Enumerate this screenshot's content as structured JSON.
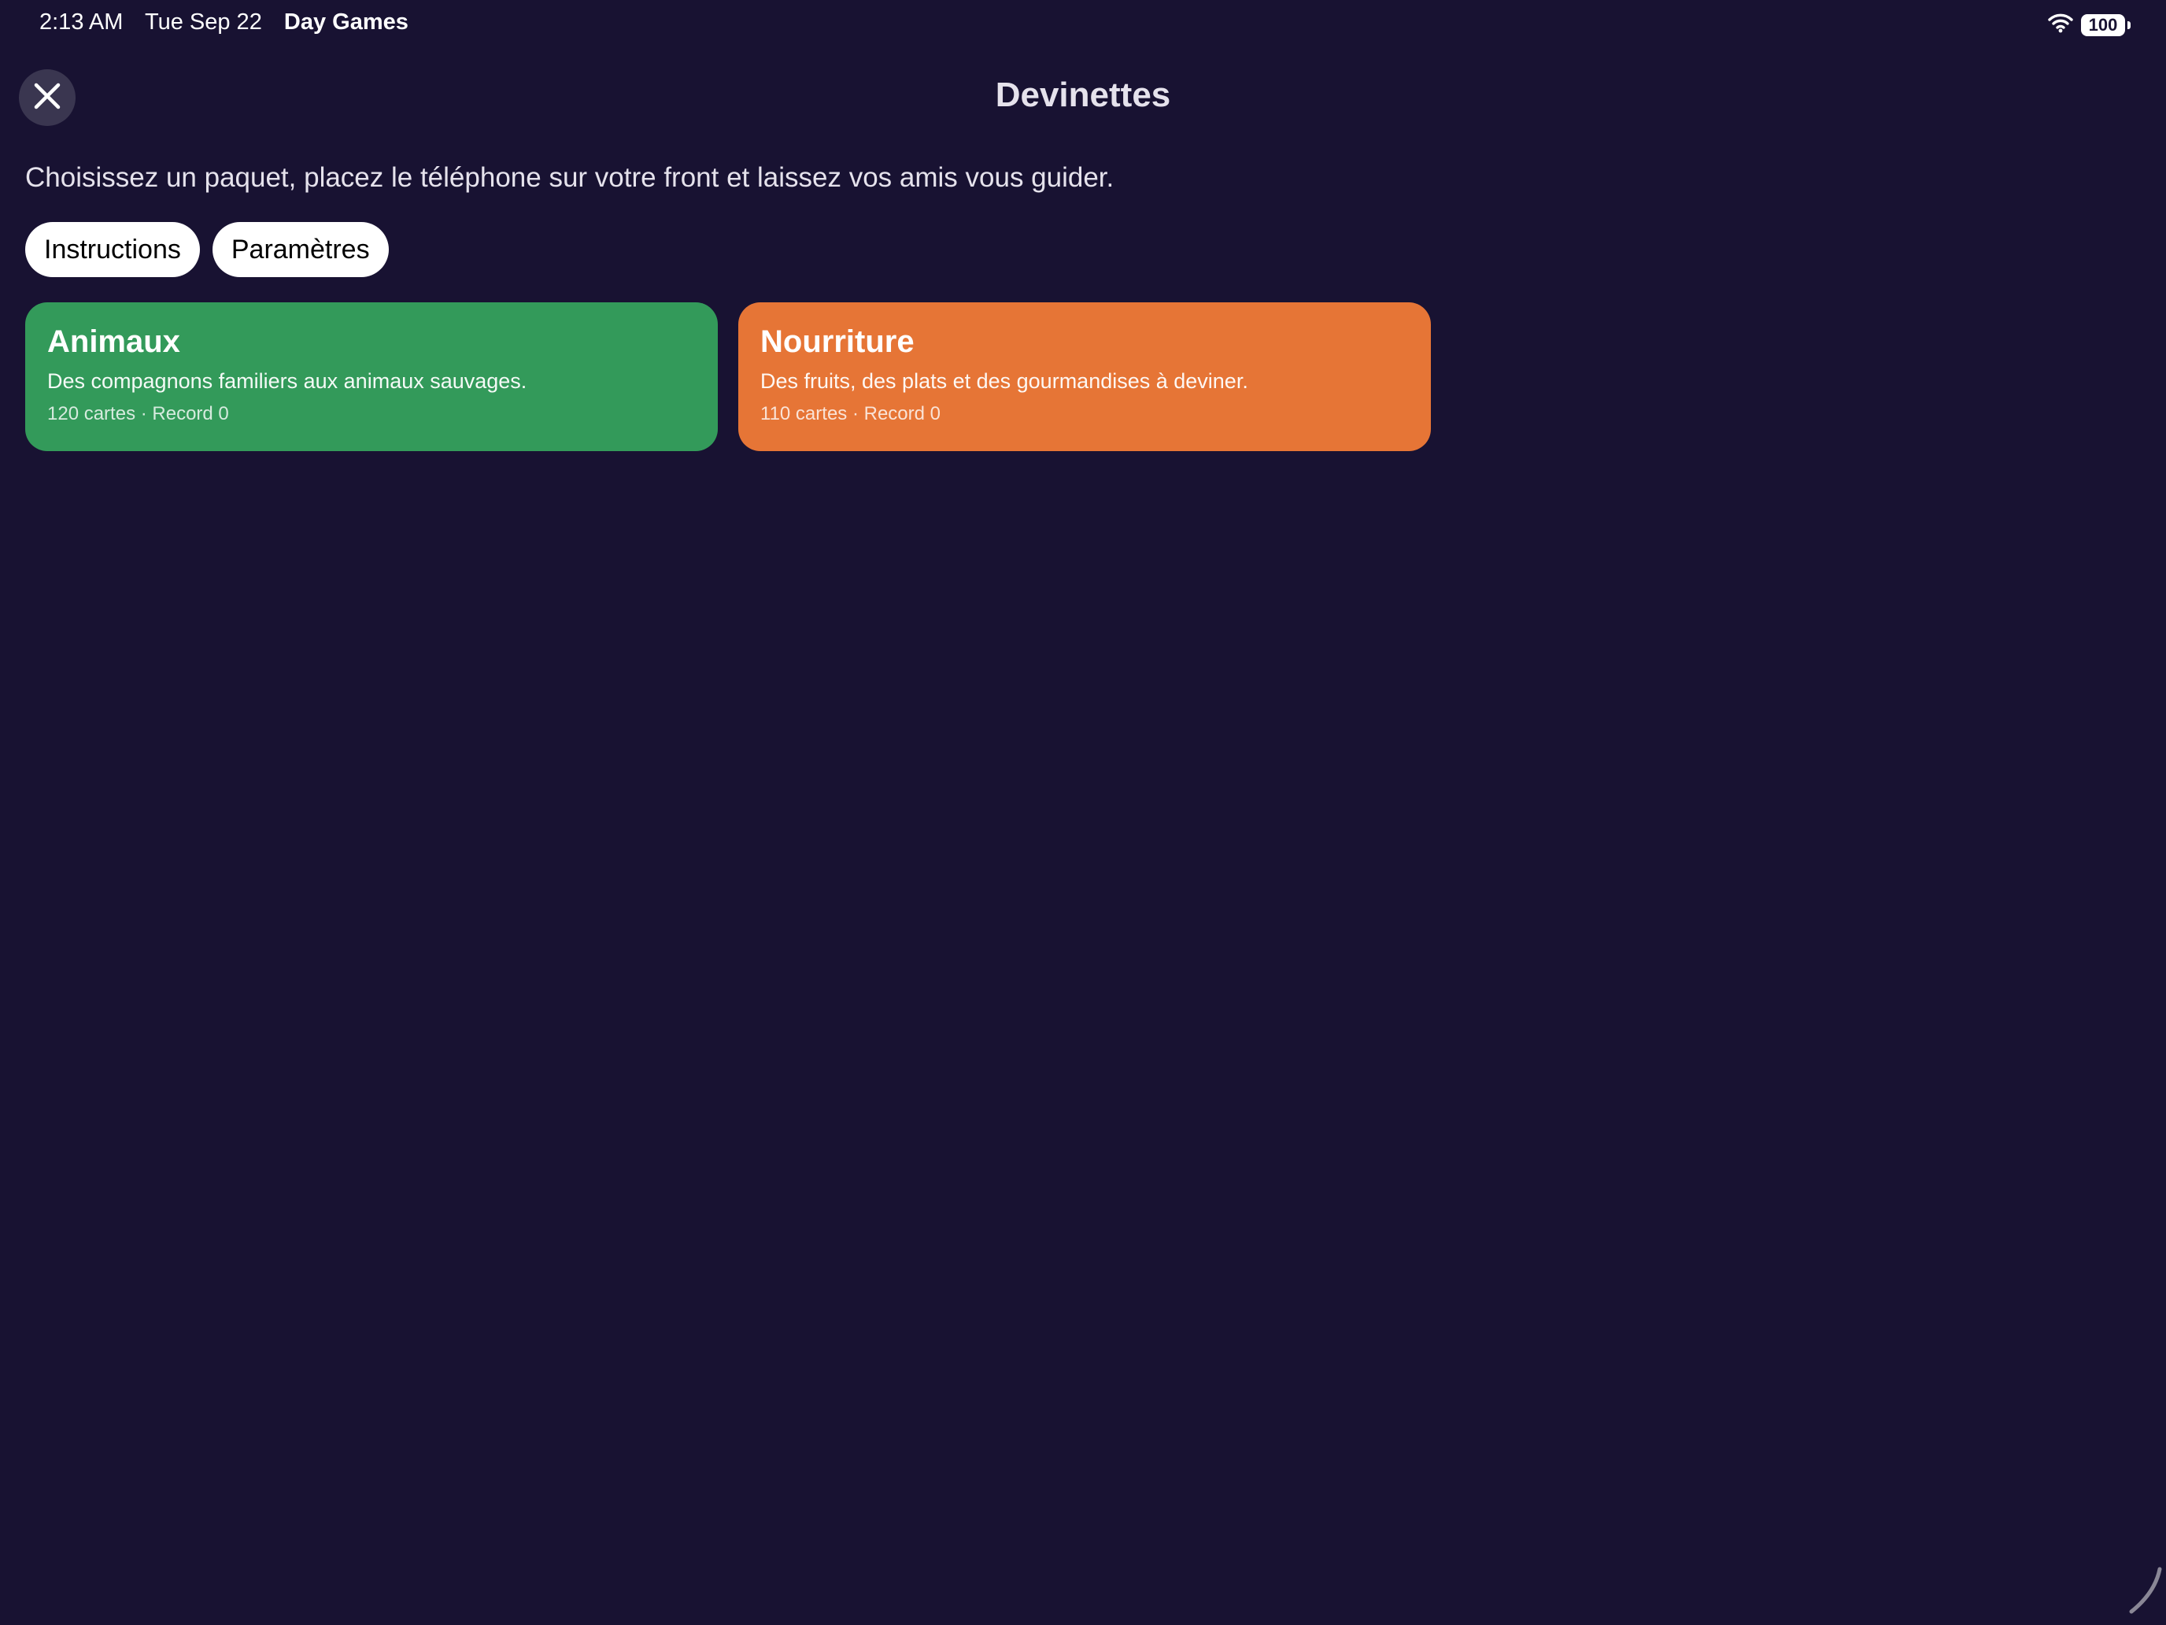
{
  "status_bar": {
    "time": "2:13 AM",
    "date": "Tue Sep 22",
    "app_name": "Day Games",
    "wifi_icon": "wifi-icon",
    "battery_level": "100"
  },
  "header": {
    "title": "Devinettes",
    "close_icon": "close-icon"
  },
  "intro": {
    "text": "Choisissez un paquet, placez le téléphone sur votre front et laissez vos amis vous guider."
  },
  "actions": {
    "instructions_label": "Instructions",
    "settings_label": "Paramètres"
  },
  "decks": [
    {
      "title": "Animaux",
      "description": "Des compagnons familiers aux animaux sauvages.",
      "meta": "120 cartes · Record 0",
      "color": "#339a5a"
    },
    {
      "title": "Nourriture",
      "description": "Des fruits, des plats et des gourmandises à deviner.",
      "meta": "110 cartes · Record 0",
      "color": "#e67536"
    }
  ]
}
